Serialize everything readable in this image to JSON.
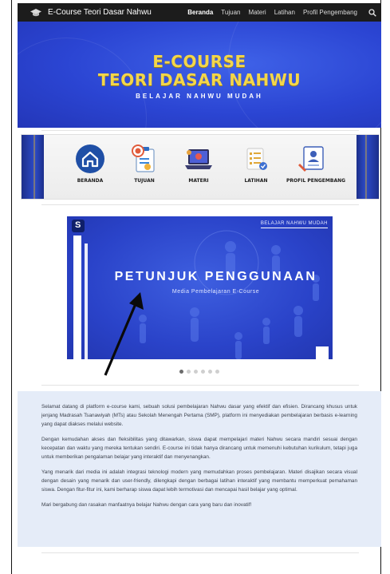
{
  "navbar": {
    "brand": "E-Course Teori Dasar Nahwu",
    "links": [
      {
        "label": "Beranda"
      },
      {
        "label": "Tujuan"
      },
      {
        "label": "Materi"
      },
      {
        "label": "Latihan"
      },
      {
        "label": "Profil Pengembang"
      }
    ],
    "icons": [
      "graduation-cap-icon",
      "search-icon"
    ]
  },
  "hero": {
    "line1": "E-COURSE",
    "line2": "TEORI DASAR NAHWU",
    "subtitle": "BELAJAR NAHWU MUDAH"
  },
  "menu": {
    "items": [
      {
        "label": "BERANDA",
        "icon": "home-icon"
      },
      {
        "label": "TUJUAN",
        "icon": "target-clipboard-icon"
      },
      {
        "label": "MATERI",
        "icon": "laptop-icon"
      },
      {
        "label": "LATIHAN",
        "icon": "checklist-icon"
      },
      {
        "label": "PROFIL PENGEMBANG",
        "icon": "profile-card-icon"
      }
    ]
  },
  "slider": {
    "tag": "BELAJAR NAHWU MUDAH",
    "title": "PETUNJUK PENGGUNAAN",
    "subtitle": "Media Pembelajaran E-Course",
    "active_index": 0,
    "slide_count": 6
  },
  "content": {
    "paragraphs": [
      "Selamat datang di platform e-course kami, sebuah solusi pembelajaran Nahwu dasar yang efektif dan efisien. Dirancang khusus untuk jenjang Madrasah Tsanawiyah (MTs) atau Sekolah Menengah Pertama (SMP), platform ini menyediakan pembelajaran berbasis e-learning yang dapat diakses melalui website.",
      "Dengan kemudahan akses dan fleksibilitas yang ditawarkan, siswa dapat mempelajari materi Nahwu secara mandiri sesuai dengan kecepatan dan waktu yang mereka tentukan sendiri. E-course ini tidak hanya dirancang untuk memenuhi kebutuhan kurikulum, tetapi juga untuk memberikan pengalaman belajar yang interaktif dan menyenangkan.",
      "Yang menarik dari media ini adalah integrasi teknologi modern yang memudahkan proses pembelajaran. Materi disajikan secara visual dengan desain yang menarik dan user-friendly, dilengkapi dengan berbagai latihan interaktif yang membantu memperkuat pemahaman siswa. Dengan fitur-fitur ini, kami berharap siswa dapat lebih termotivasi dan mencapai hasil belajar yang optimal.",
      "Mari bergabung dan rasakan manfaatnya belajar Nahwu dengan cara yang baru dan inovatif!"
    ]
  },
  "colors": {
    "navbar": "#1c1c1c",
    "hero_blue": "#2b45d3",
    "hero_gold": "#f3d64a",
    "content_bg": "#e5ecf8"
  }
}
